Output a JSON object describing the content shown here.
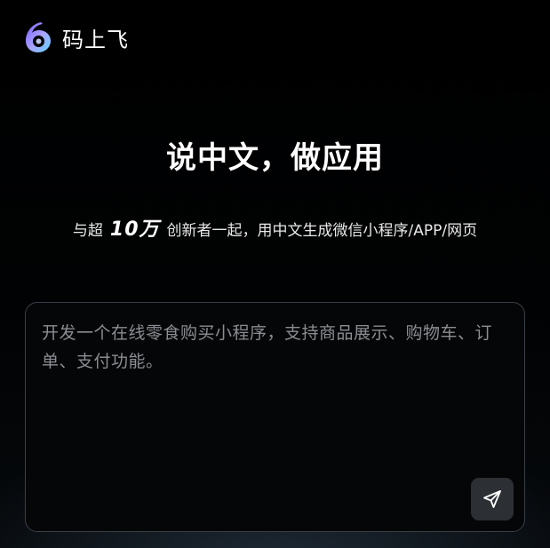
{
  "brand": {
    "logo_icon": "brand-logo-icon",
    "name": "码上飞"
  },
  "hero": {
    "title": "说中文，做应用",
    "subtitle_prefix": "与超",
    "subtitle_number": "10万",
    "subtitle_suffix": "创新者一起，用中文生成微信小程序/APP/网页"
  },
  "prompt": {
    "text": "开发一个在线零食购买小程序，支持商品展示、购物车、订单、支付功能。",
    "send_icon": "send-icon"
  },
  "colors": {
    "background": "#000000",
    "box_border": "#3a3f47",
    "prompt_text": "#8a8d92",
    "send_button_bg": "#2c2f34",
    "logo_gradient_start": "#7b5cff",
    "logo_gradient_end": "#5fd6ff"
  }
}
